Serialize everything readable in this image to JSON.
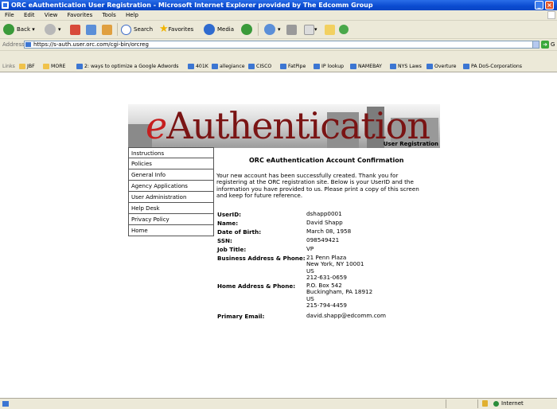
{
  "window": {
    "title": "ORC eAuthentication User Registration - Microsoft Internet Explorer provided by The Edcomm Group"
  },
  "menu": [
    "File",
    "Edit",
    "View",
    "Favorites",
    "Tools",
    "Help"
  ],
  "toolbar": {
    "back": "Back",
    "search": "Search",
    "favorites": "Favorites",
    "media": "Media"
  },
  "address": {
    "label": "Address",
    "url": "https://s-auth.user.orc.com/cgi-bin/orcreg",
    "go": "G"
  },
  "links": {
    "label": "Links",
    "items": [
      "JBF",
      "MORE",
      "2: ways to optimize a Google Adwords",
      "401K",
      "allegiance",
      "CISCO",
      "FatPipe",
      "IP lookup",
      "NAMEBAY",
      "NYS Laws",
      "Overture",
      "PA DoS-Corporations"
    ]
  },
  "banner": {
    "logo_e": "e",
    "logo_rest": "Authentication",
    "subtitle": "User Registration"
  },
  "nav": [
    "Instructions",
    "Policies",
    "General Info",
    "Agency Applications",
    "User Administration",
    "Help Desk",
    "Privacy Policy",
    "Home"
  ],
  "main": {
    "heading": "ORC eAuthentication Account Confirmation",
    "intro": "Your new account has been successfully created. Thank you for registering at the ORC registration site. Below is your UserID and the information you have provided to us. Please print a copy of this screen and keep for future reference.",
    "fields": [
      {
        "label": "UserID:",
        "value": "dshapp0001"
      },
      {
        "label": "Name:",
        "value": "David Shapp"
      },
      {
        "label": "Date of Birth:",
        "value": "March 08, 1958"
      },
      {
        "label": "SSN:",
        "value": "098549421"
      },
      {
        "label": "Job Title:",
        "value": "VP"
      },
      {
        "label": "Business Address & Phone:",
        "value": "21 Penn Plaza\nNew York, NY 10001\nUS\n212-631-0659"
      },
      {
        "label": "Home Address & Phone:",
        "value": "P.O. Box 542\nBuckingham, PA 18912\nUS\n215-794-4459"
      },
      {
        "label": "Primary Email:",
        "value": "david.shapp@edcomm.com"
      }
    ]
  },
  "status": {
    "zone": "Internet"
  }
}
